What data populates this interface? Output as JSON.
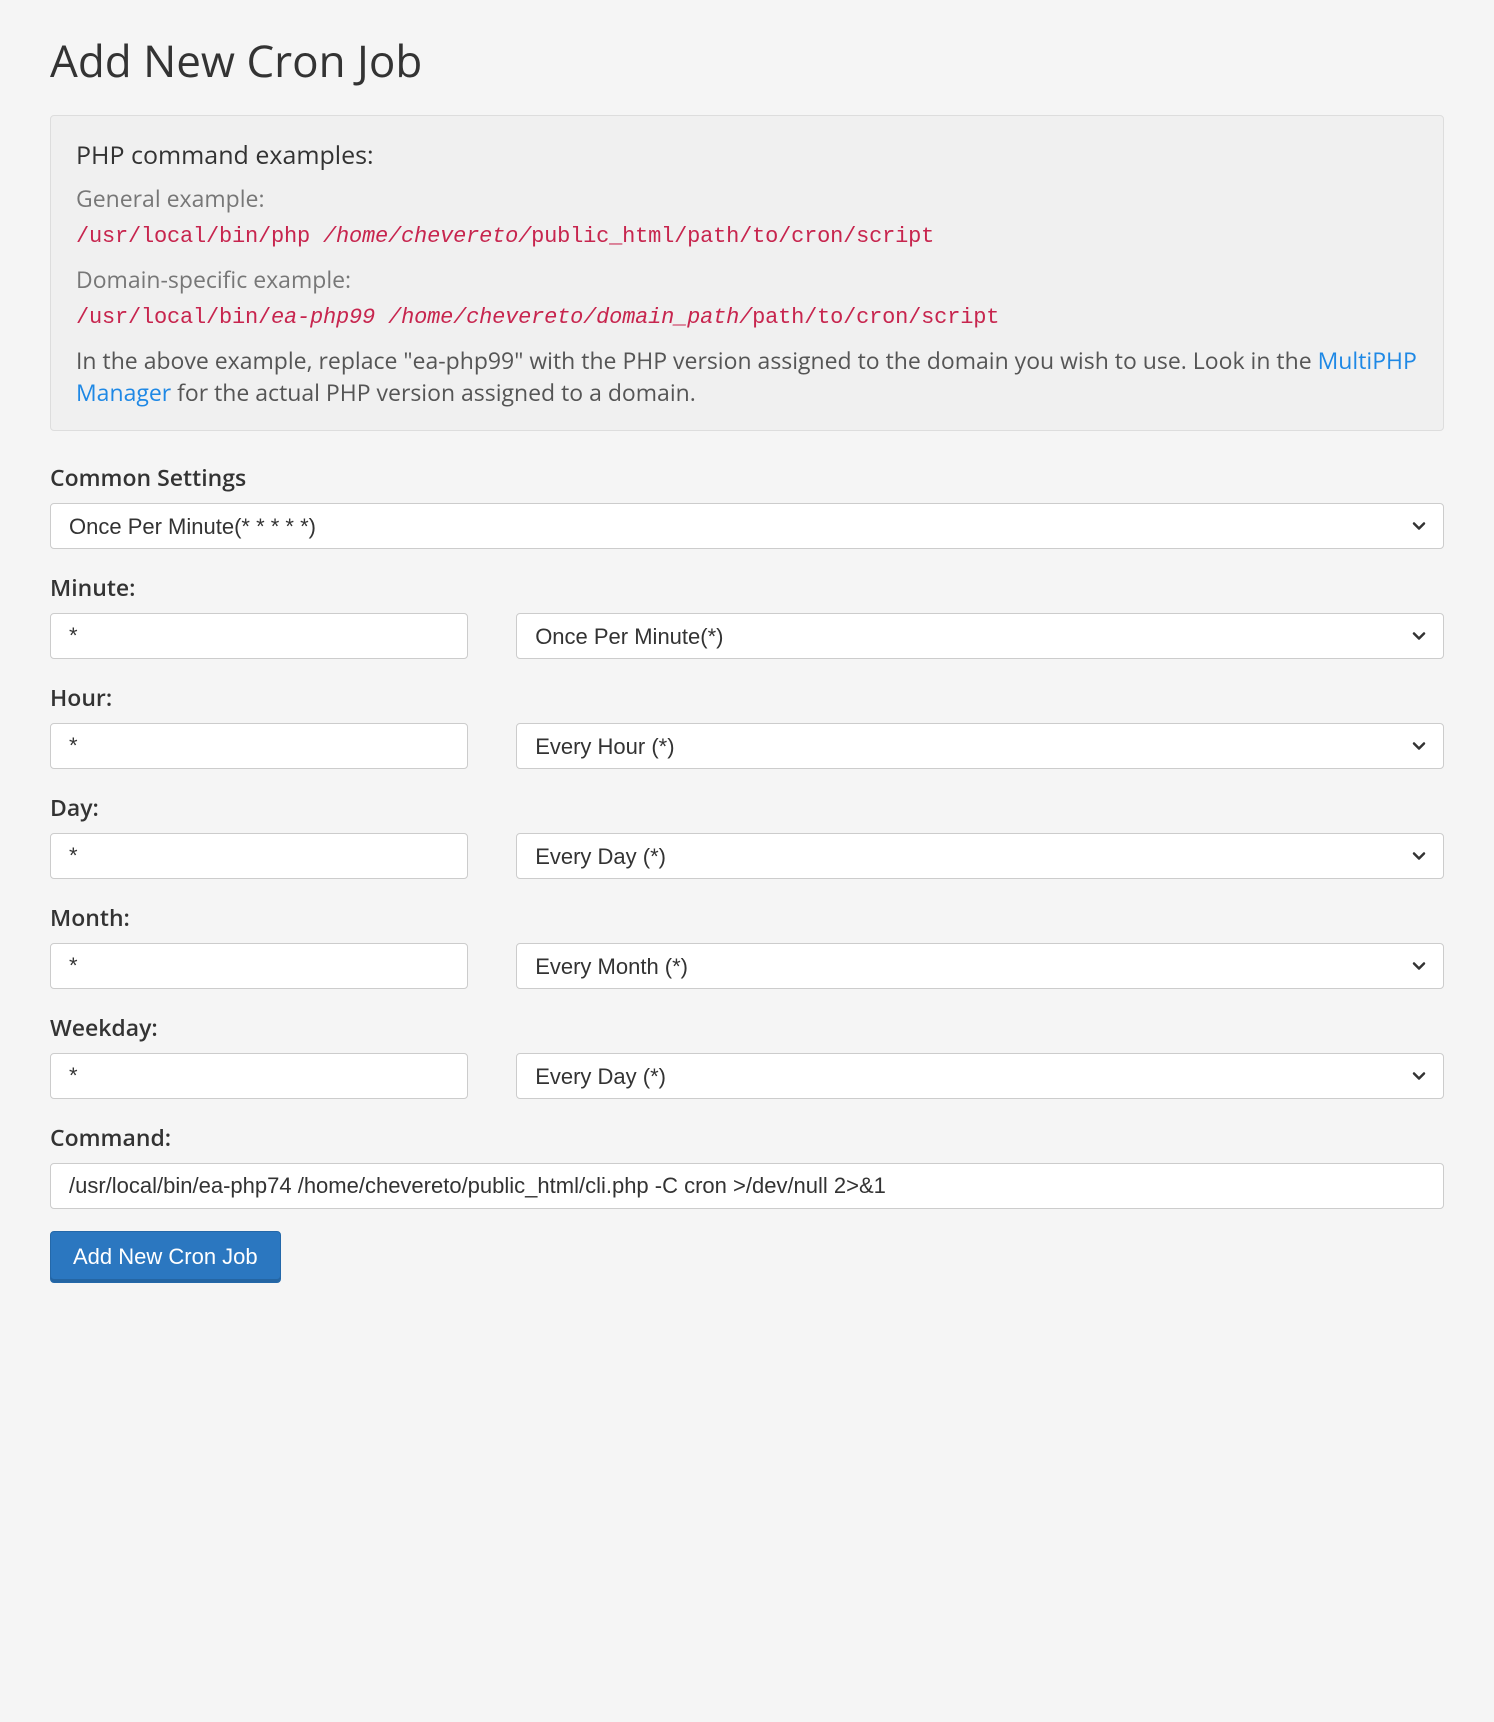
{
  "title": "Add New Cron Job",
  "info": {
    "heading": "PHP command examples:",
    "general_label": "General example:",
    "general_code_prefix": "/usr/local/bin/php ",
    "general_code_italic": "/home/chevereto/",
    "general_code_suffix": "public_html/path/to/cron/script",
    "domain_label": "Domain-specific example:",
    "domain_code_prefix": "/usr/local/bin/",
    "domain_code_italic1": "ea-php99",
    "domain_code_mid": " ",
    "domain_code_italic2": "/home/chevereto/domain_path/",
    "domain_code_suffix": "path/to/cron/script",
    "note_part1": "In the above example, replace \"ea-php99\" with the PHP version assigned to the domain you wish to use. Look in the ",
    "note_link": "MultiPHP Manager",
    "note_part2": " for the actual PHP version assigned to a domain."
  },
  "common_settings": {
    "label": "Common Settings",
    "selected": "Once Per Minute(* * * * *)"
  },
  "minute": {
    "label": "Minute:",
    "value": "*",
    "preset": "Once Per Minute(*)"
  },
  "hour": {
    "label": "Hour:",
    "value": "*",
    "preset": "Every Hour (*)"
  },
  "day": {
    "label": "Day:",
    "value": "*",
    "preset": "Every Day (*)"
  },
  "month": {
    "label": "Month:",
    "value": "*",
    "preset": "Every Month (*)"
  },
  "weekday": {
    "label": "Weekday:",
    "value": "*",
    "preset": "Every Day (*)"
  },
  "command": {
    "label": "Command:",
    "value": "/usr/local/bin/ea-php74 /home/chevereto/public_html/cli.php -C cron >/dev/null 2>&1"
  },
  "submit_label": "Add New Cron Job"
}
